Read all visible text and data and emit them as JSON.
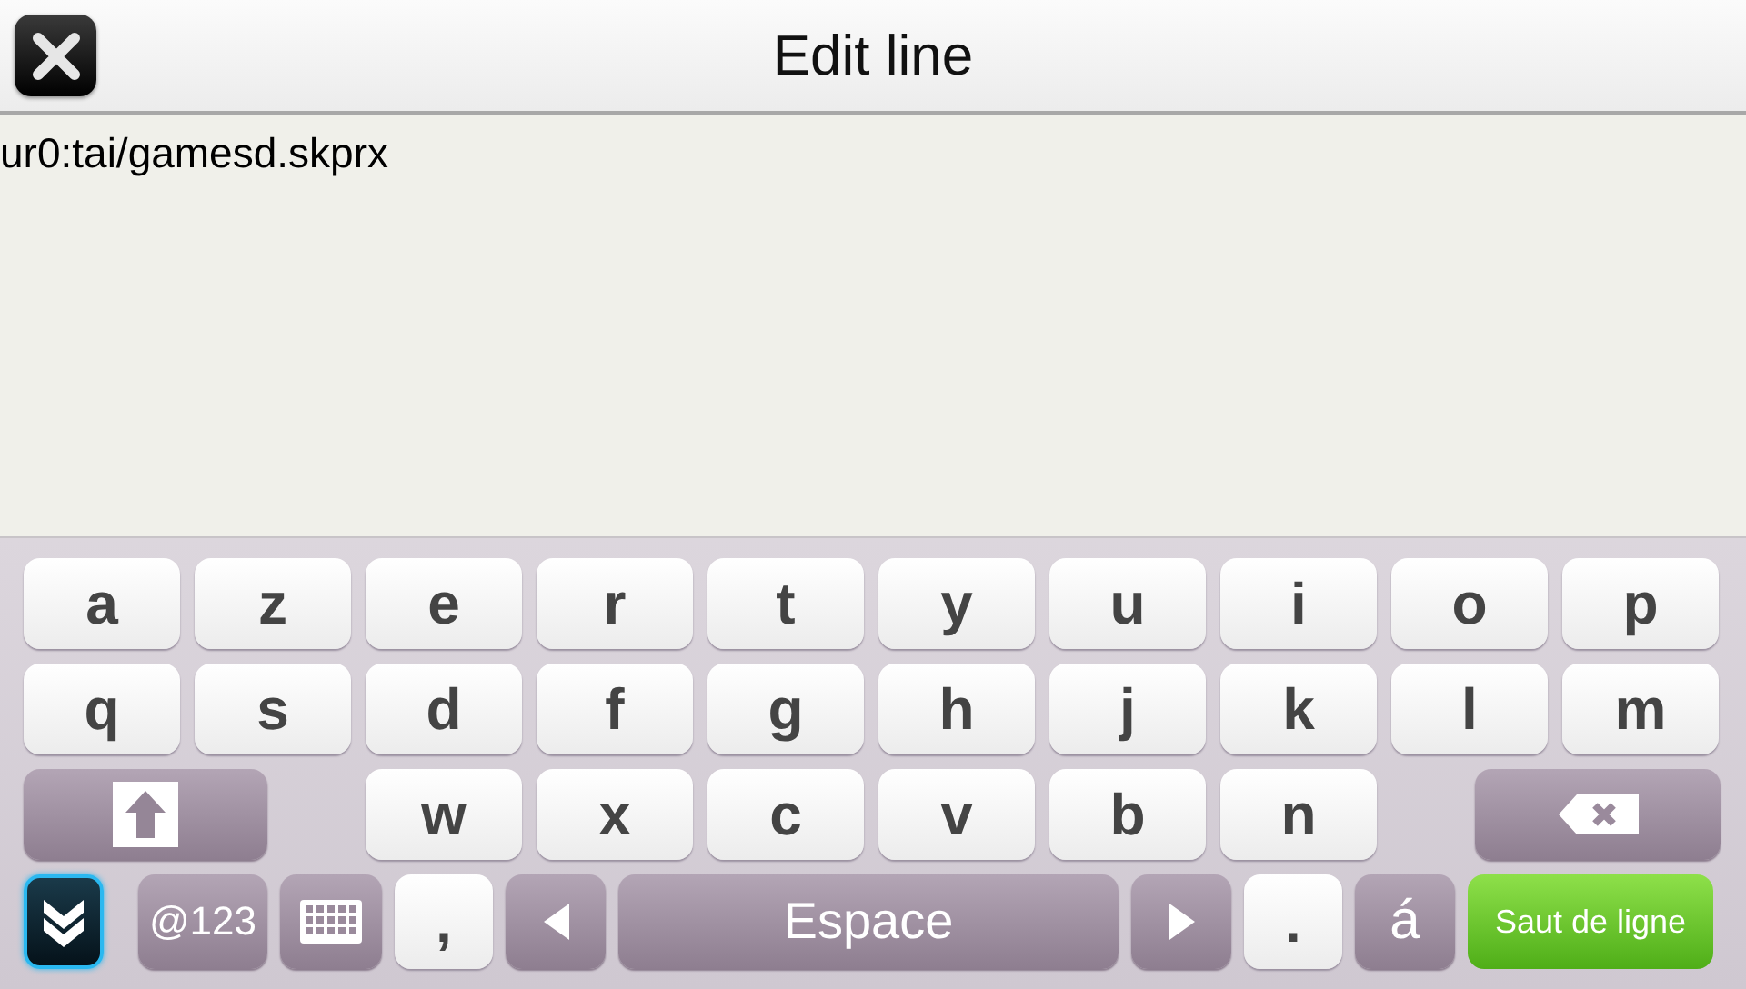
{
  "header": {
    "title": "Edit line"
  },
  "editor": {
    "value": "ur0:tai/gamesd.skprx"
  },
  "keyboard": {
    "rows": [
      {
        "keys": [
          {
            "kind": "char",
            "label": "a"
          },
          {
            "kind": "char",
            "label": "z"
          },
          {
            "kind": "char",
            "label": "e"
          },
          {
            "kind": "char",
            "label": "r"
          },
          {
            "kind": "char",
            "label": "t"
          },
          {
            "kind": "char",
            "label": "y"
          },
          {
            "kind": "char",
            "label": "u"
          },
          {
            "kind": "char",
            "label": "i"
          },
          {
            "kind": "char",
            "label": "o"
          },
          {
            "kind": "char",
            "label": "p"
          }
        ]
      },
      {
        "keys": [
          {
            "kind": "char",
            "label": "q"
          },
          {
            "kind": "char",
            "label": "s"
          },
          {
            "kind": "char",
            "label": "d"
          },
          {
            "kind": "char",
            "label": "f"
          },
          {
            "kind": "char",
            "label": "g"
          },
          {
            "kind": "char",
            "label": "h"
          },
          {
            "kind": "char",
            "label": "j"
          },
          {
            "kind": "char",
            "label": "k"
          },
          {
            "kind": "char",
            "label": "l"
          },
          {
            "kind": "char",
            "label": "m"
          }
        ]
      },
      {
        "keys": [
          {
            "kind": "shift"
          },
          {
            "kind": "char",
            "label": "w"
          },
          {
            "kind": "char",
            "label": "x"
          },
          {
            "kind": "char",
            "label": "c"
          },
          {
            "kind": "char",
            "label": "v"
          },
          {
            "kind": "char",
            "label": "b"
          },
          {
            "kind": "char",
            "label": "n"
          },
          {
            "kind": "backspace"
          }
        ]
      },
      {
        "keys": [
          {
            "kind": "hide"
          },
          {
            "kind": "symbols",
            "label": "@123"
          },
          {
            "kind": "layout"
          },
          {
            "kind": "punct",
            "label": ","
          },
          {
            "kind": "left"
          },
          {
            "kind": "space",
            "label": "Espace"
          },
          {
            "kind": "right"
          },
          {
            "kind": "punct",
            "label": "."
          },
          {
            "kind": "accent",
            "label": "á"
          },
          {
            "kind": "enter",
            "label": "Saut de ligne"
          }
        ]
      }
    ]
  }
}
